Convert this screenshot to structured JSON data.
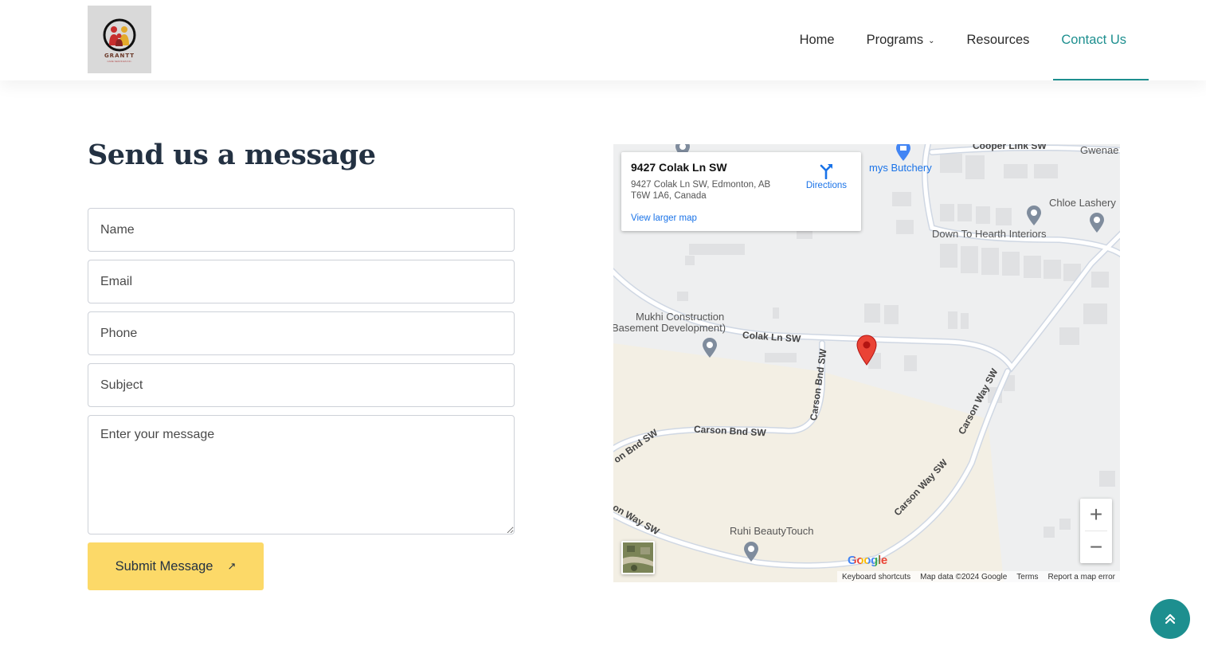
{
  "header": {
    "logo": {
      "brand": "GRANTT",
      "tagline": "CARE SERVICES INC."
    },
    "nav": [
      {
        "label": "Home",
        "active": false
      },
      {
        "label": "Programs",
        "active": false,
        "has_dropdown": true
      },
      {
        "label": "Resources",
        "active": false
      },
      {
        "label": "Contact Us",
        "active": true
      }
    ],
    "accent_color": "#1d8f8f"
  },
  "form": {
    "title": "Send us a message",
    "name_placeholder": "Name",
    "email_placeholder": "Email",
    "phone_placeholder": "Phone",
    "subject_placeholder": "Subject",
    "message_placeholder": "Enter your message",
    "submit_label": "Submit Message",
    "submit_icon": "arrow-up-right-icon",
    "submit_color": "#fcd968"
  },
  "map": {
    "info": {
      "title": "9427 Colak Ln SW",
      "address_line1": "9427 Colak Ln SW, Edmonton, AB",
      "address_line2": "T6W 1A6, Canada",
      "view_larger": "View larger map",
      "directions": "Directions"
    },
    "places": {
      "butchery": "mys Butchery",
      "chloe": "Chloe Lashery",
      "hearth": "Down To Hearth Interiors",
      "mukhi1": "Mukhi Construction",
      "mukhi2": "Basement Development)",
      "ruhi": "Ruhi BeautyTouch",
      "gwenae": "Gwenae",
      "cooper": "Cooper Link SW"
    },
    "streets": {
      "colak": "Colak Ln SW",
      "carson_bnd": "Carson Bnd SW",
      "carson_bnd_vertical": "Carson Bnd SW",
      "carson_bnd_left": "on Bnd SW",
      "carson_way1": "Carson Way SW",
      "carson_way2": "Carson Way SW",
      "carson_way_left": "on Way SW"
    },
    "zoom_in": "+",
    "zoom_out": "−",
    "google": "Google",
    "footer": {
      "shortcuts": "Keyboard shortcuts",
      "data": "Map data ©2024 Google",
      "terms": "Terms",
      "report": "Report a map error"
    }
  },
  "back_to_top_icon": "double-chevron-up-icon"
}
